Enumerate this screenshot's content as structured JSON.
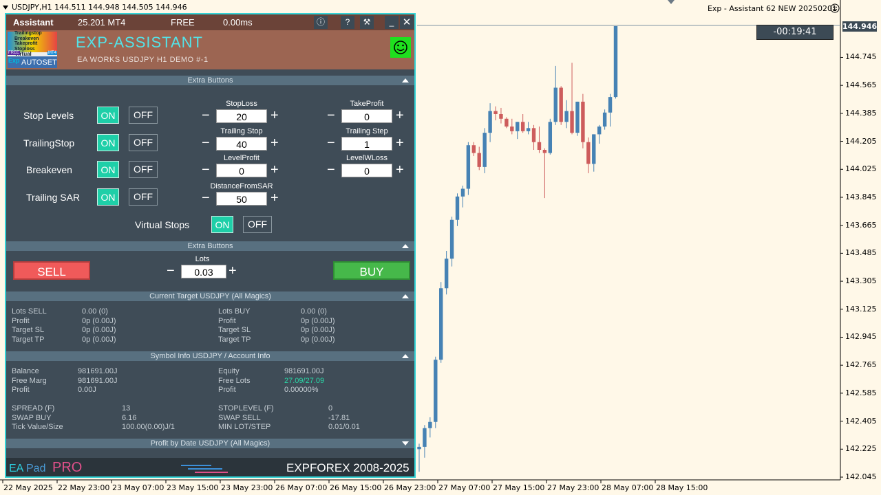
{
  "chart": {
    "symbol_info": "USDJPY,H1  144.511 144.948 144.505 144.946",
    "ea_label": "Exp - Assistant 62 NEW 20250201",
    "current_price": "144.946",
    "timer": "-00:19:41",
    "price_axis": [
      "144.745",
      "144.565",
      "144.385",
      "144.205",
      "144.025",
      "143.845",
      "143.665",
      "143.485",
      "143.305",
      "143.125",
      "142.945",
      "142.765",
      "142.585",
      "142.405",
      "142.225",
      "142.045"
    ],
    "date_axis": [
      "22 May 2025",
      "22 May 23:00",
      "23 May 07:00",
      "23 May 15:00",
      "23 May 23:00",
      "26 May 07:00",
      "26 May 15:00",
      "26 May 23:00",
      "27 May 07:00",
      "27 May 15:00",
      "27 May 23:00",
      "28 May 07:00",
      "28 May 15:00"
    ],
    "colors": {
      "bull": "#4682b4",
      "bear": "#cd5c5c",
      "background": "#fff8e8",
      "price_line": "#7f95a5"
    },
    "candles": [
      {
        "o": 142.225,
        "h": 142.26,
        "l": 142.08,
        "c": 142.24
      },
      {
        "o": 142.24,
        "h": 142.38,
        "l": 142.17,
        "c": 142.36
      },
      {
        "o": 142.36,
        "h": 142.43,
        "l": 142.3,
        "c": 142.4
      },
      {
        "o": 142.4,
        "h": 142.82,
        "l": 142.36,
        "c": 142.8
      },
      {
        "o": 142.8,
        "h": 143.3,
        "l": 142.78,
        "c": 143.26
      },
      {
        "o": 143.26,
        "h": 143.5,
        "l": 143.22,
        "c": 143.45
      },
      {
        "o": 143.45,
        "h": 143.72,
        "l": 143.4,
        "c": 143.7
      },
      {
        "o": 143.7,
        "h": 143.87,
        "l": 143.66,
        "c": 143.85
      },
      {
        "o": 143.85,
        "h": 143.92,
        "l": 143.78,
        "c": 143.9
      },
      {
        "o": 143.9,
        "h": 144.2,
        "l": 143.86,
        "c": 144.18
      },
      {
        "o": 144.18,
        "h": 144.2,
        "l": 144.11,
        "c": 144.13
      },
      {
        "o": 144.13,
        "h": 144.17,
        "l": 144.02,
        "c": 144.04
      },
      {
        "o": 144.04,
        "h": 144.29,
        "l": 144.0,
        "c": 144.26
      },
      {
        "o": 144.26,
        "h": 144.45,
        "l": 144.2,
        "c": 144.4
      },
      {
        "o": 144.4,
        "h": 144.43,
        "l": 144.34,
        "c": 144.38
      },
      {
        "o": 144.38,
        "h": 144.42,
        "l": 144.32,
        "c": 144.35
      },
      {
        "o": 144.35,
        "h": 144.36,
        "l": 144.29,
        "c": 144.3
      },
      {
        "o": 144.3,
        "h": 144.35,
        "l": 144.25,
        "c": 144.27
      },
      {
        "o": 144.27,
        "h": 144.33,
        "l": 144.22,
        "c": 144.33
      },
      {
        "o": 144.33,
        "h": 144.38,
        "l": 144.26,
        "c": 144.27
      },
      {
        "o": 144.27,
        "h": 144.33,
        "l": 144.25,
        "c": 144.29
      },
      {
        "o": 144.29,
        "h": 144.31,
        "l": 144.15,
        "c": 144.2
      },
      {
        "o": 144.2,
        "h": 144.3,
        "l": 144.13,
        "c": 144.15
      },
      {
        "o": 144.15,
        "h": 144.16,
        "l": 143.84,
        "c": 144.13
      },
      {
        "o": 144.13,
        "h": 144.35,
        "l": 144.12,
        "c": 144.33
      },
      {
        "o": 144.33,
        "h": 144.69,
        "l": 144.31,
        "c": 144.55
      },
      {
        "o": 144.55,
        "h": 144.56,
        "l": 144.31,
        "c": 144.33
      },
      {
        "o": 144.33,
        "h": 144.47,
        "l": 144.29,
        "c": 144.4
      },
      {
        "o": 144.4,
        "h": 144.71,
        "l": 144.25,
        "c": 144.26
      },
      {
        "o": 144.26,
        "h": 144.46,
        "l": 144.24,
        "c": 144.46
      },
      {
        "o": 144.46,
        "h": 144.51,
        "l": 144.16,
        "c": 144.2
      },
      {
        "o": 144.2,
        "h": 144.23,
        "l": 144.0,
        "c": 144.06
      },
      {
        "o": 144.06,
        "h": 144.25,
        "l": 144.01,
        "c": 144.25
      },
      {
        "o": 144.25,
        "h": 144.31,
        "l": 144.19,
        "c": 144.3
      },
      {
        "o": 144.3,
        "h": 144.41,
        "l": 144.28,
        "c": 144.39
      },
      {
        "o": 144.39,
        "h": 144.51,
        "l": 144.3,
        "c": 144.49
      },
      {
        "o": 144.49,
        "h": 144.946,
        "l": 144.48,
        "c": 144.946
      }
    ]
  },
  "panel": {
    "title_left": "Assistant",
    "version": "25.201 MT4",
    "license": "FREE",
    "ping": "0.00ms",
    "tb_info": "ⓘ",
    "tb_help": "?",
    "tb_tools": "⚒",
    "tb_min": "_",
    "tb_close": "✕",
    "logo_lines": [
      "Trailingstop",
      "Breakeven",
      "Takeprofit",
      "Stoploss",
      "Virtual"
    ],
    "logo_free": "FREE",
    "logo_mt4": "MT4",
    "logo_exp": "Exp",
    "logo_autoset": "AUTOSET",
    "ea_title": "EXP-ASSISTANT",
    "ea_subtitle": "EA WORKS USDJPY H1 DEMO  #-1",
    "section_extra": "Extra Buttons",
    "rows": [
      {
        "label": "Stop Levels",
        "on": "ON",
        "off": "OFF"
      },
      {
        "label": "TrailingStop",
        "on": "ON",
        "off": "OFF"
      },
      {
        "label": "Breakeven",
        "on": "ON",
        "off": "OFF"
      },
      {
        "label": "Trailing SAR",
        "on": "ON",
        "off": "OFF"
      }
    ],
    "fields": {
      "stoploss": {
        "label": "StopLoss",
        "value": "20"
      },
      "takeprofit": {
        "label": "TakeProfit",
        "value": "0"
      },
      "trailing_stop": {
        "label": "Trailing Stop",
        "value": "40"
      },
      "trailing_step": {
        "label": "Trailing Step",
        "value": "1"
      },
      "level_profit": {
        "label": "LevelProfit",
        "value": "0"
      },
      "level_wloss": {
        "label": "LevelWLoss",
        "value": "0"
      },
      "distance_sar": {
        "label": "DistanceFromSAR",
        "value": "50"
      }
    },
    "minus": "−",
    "plus": "+",
    "virtual_stops": {
      "label": "Virtual Stops",
      "on": "ON",
      "off": "OFF"
    },
    "section_extra2": "Extra Buttons",
    "sell": "SELL",
    "buy": "BUY",
    "lots": {
      "label": "Lots",
      "value": "0.03"
    },
    "section_target": "Current Target USDJPY (All Magics)",
    "target": {
      "left_labels": [
        "Lots SELL",
        "Profit",
        "Target SL",
        "Target TP"
      ],
      "left_values": [
        "0.00 (0)",
        "0p (0.00J)",
        "0p (0.00J)",
        "0p (0.00J)"
      ],
      "right_labels": [
        "Lots BUY",
        "Profit",
        "Target SL",
        "Target TP"
      ],
      "right_values": [
        "0.00 (0)",
        "0p (0.00J)",
        "0p (0.00J)",
        "0p (0.00J)"
      ]
    },
    "section_symbol": "Symbol Info USDJPY / Account Info",
    "account": {
      "left_labels": [
        "Balance",
        "Free Marg",
        "Profit"
      ],
      "left_values": [
        "981691.00J",
        "981691.00J",
        "0.00J"
      ],
      "right_labels": [
        "Equity",
        "Free Lots",
        "Profit"
      ],
      "right_values": [
        "981691.00J",
        "27.09/27.09",
        "0.00000%"
      ]
    },
    "symbol": {
      "left_labels": [
        "SPREAD (F)",
        "SWAP BUY",
        "Tick Value/Size"
      ],
      "left_values": [
        "13",
        "6.16",
        "100.00(0.00)J/1"
      ],
      "right_labels": [
        "STOPLEVEL (F)",
        "SWAP SELL",
        "MIN LOT/STEP"
      ],
      "right_values": [
        "0",
        "-17.81",
        "0.01/0.01"
      ]
    },
    "section_profit": "Profit by Date USDJPY (All Magics)",
    "footer": {
      "ea": "EA",
      "pad": "Pad",
      "pro": "PRO",
      "copyright": "EXPFOREX 2008-2025"
    }
  }
}
